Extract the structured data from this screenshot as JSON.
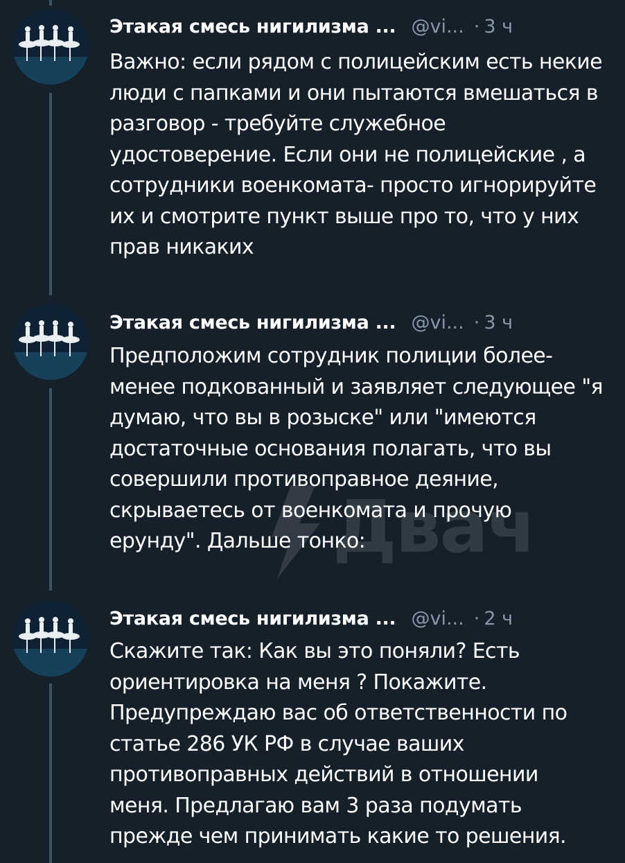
{
  "tweets": [
    {
      "author_name": "Этакая смесь нигилизма ...",
      "handle": "@vi...",
      "separator": "·",
      "time": "3 ч",
      "text": "Важно: если рядом с полицейским есть некие\nлюди с папками и они пытаются вмешаться в\nразговор - требуйте служебное\nудостоверение. Если они не полицейские , а\nсотрудники военкомата- просто игнорируйте\nих и смотрите пункт выше про то, что у них\nправ никаких"
    },
    {
      "author_name": "Этакая смесь нигилизма ...",
      "handle": "@vi...",
      "separator": "·",
      "time": "3 ч",
      "text": "Предположим сотрудник полиции более-\nменее подкованный и заявляет следующее \"я\nдумаю, что вы в розыске\" или \"имеются\nдостаточные основания полагать, что вы\nсовершили противоправное деяние,\nскрываетесь от военкомата и прочую\nерунду\". Дальше тонко:"
    },
    {
      "author_name": "Этакая смесь нигилизма ...",
      "handle": "@vi...",
      "separator": "·",
      "time": "2 ч",
      "text": "Скажите так: Как вы это поняли? Есть\nориентировка на меня ? Покажите.\nПредупреждаю вас об ответственности по\nстатье 286 УК РФ в случае ваших\nпротивоправных действий в отношении\nменя. Предлагаю вам 3 раза подумать\nпрежде чем принимать какие то решения."
    }
  ],
  "watermark": {
    "text": "Двач",
    "icon": "lightning-icon"
  },
  "colors": {
    "background": "#15202b",
    "text": "#ffffff",
    "secondary_text": "#8899a6",
    "thread_line": "#3d5466"
  }
}
